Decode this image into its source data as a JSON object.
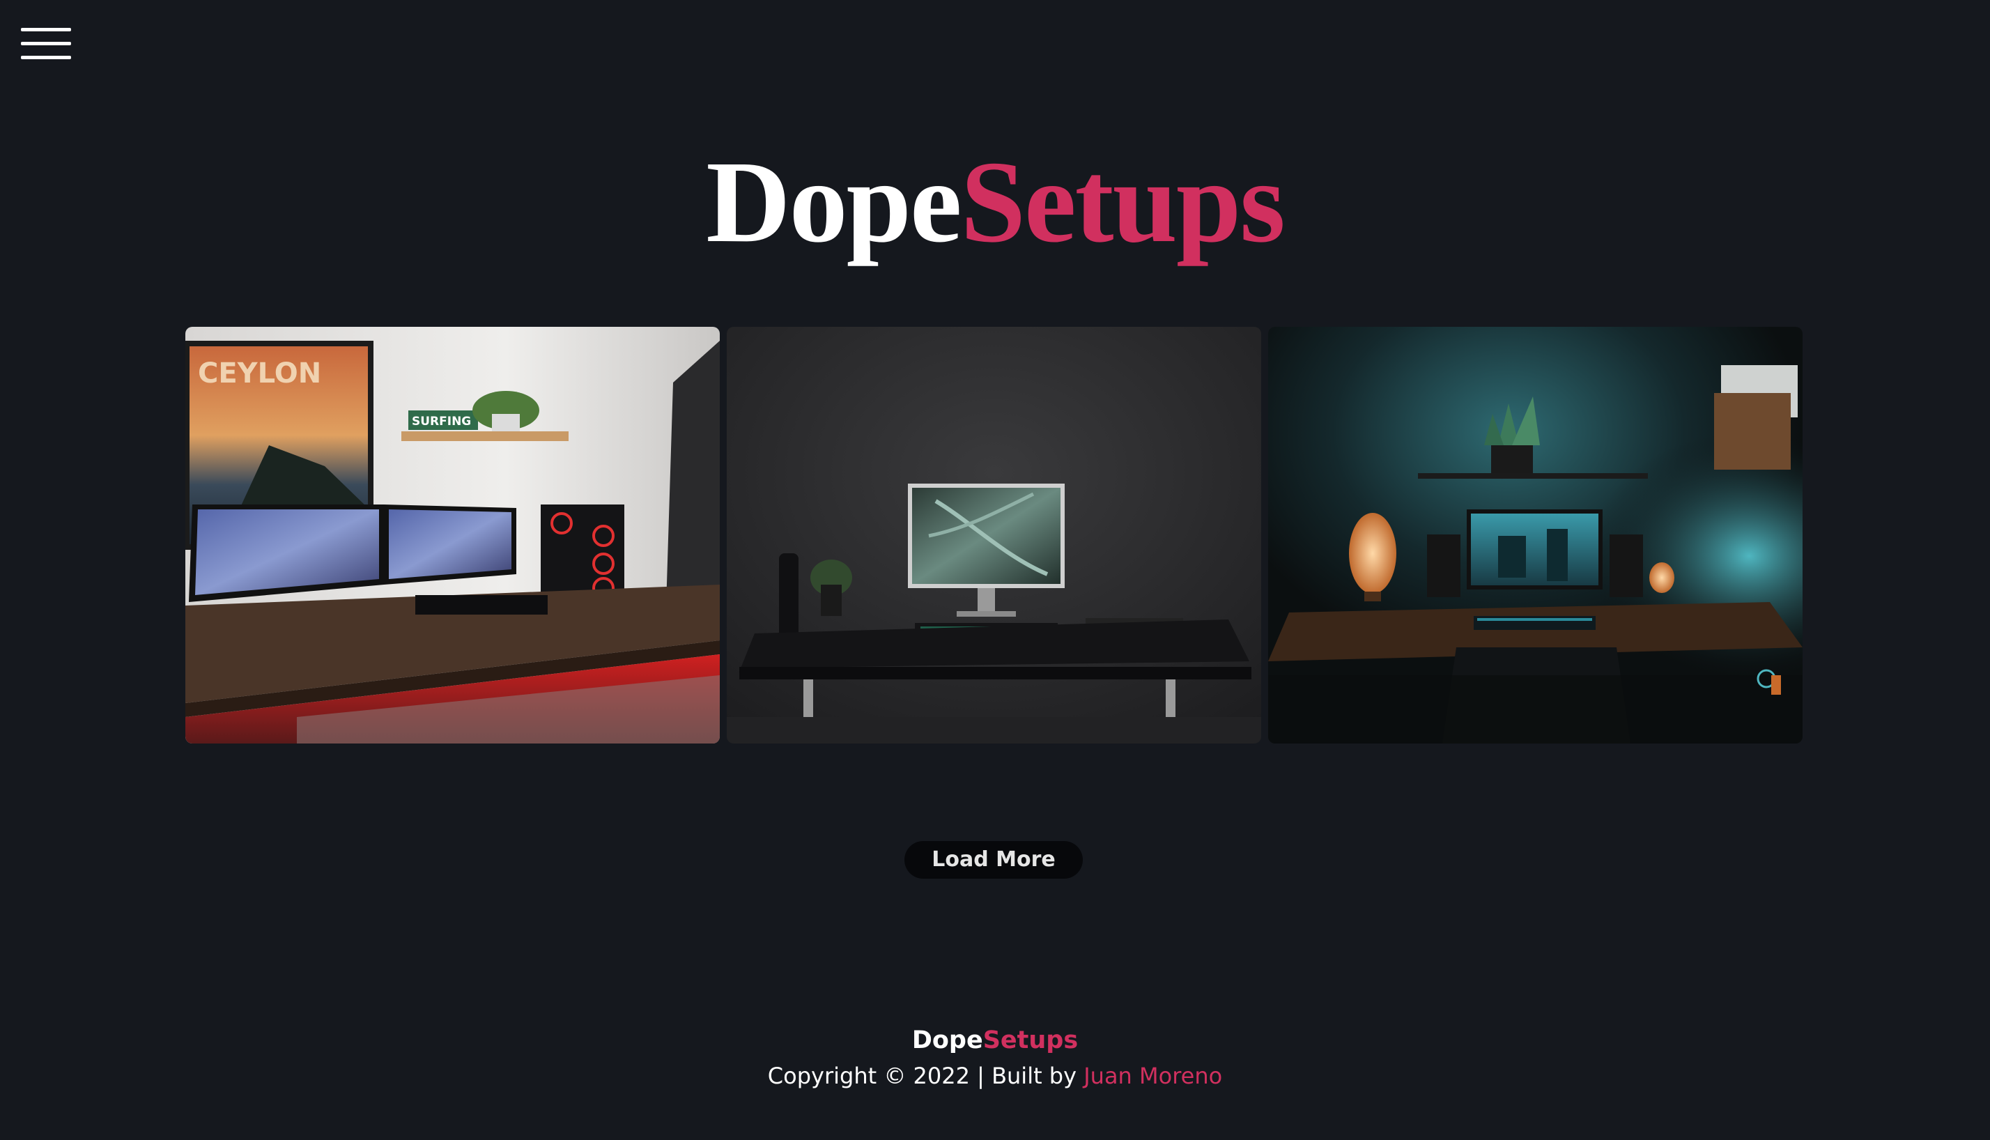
{
  "colors": {
    "background": "#15181e",
    "accent": "#d1305f",
    "button_bg": "#07080b",
    "text": "#ffffff"
  },
  "nav": {
    "menu_icon": "hamburger-menu-icon"
  },
  "logo": {
    "part1": "Dope",
    "part2": "Setups"
  },
  "gallery": {
    "images": [
      {
        "subject": "desk setup with dual curved monitors, red underglow, CEYLON poster and SURFING shelf sign"
      },
      {
        "subject": "minimal dark room desk with single monitor showing leaf wallpaper and small plant"
      },
      {
        "subject": "dark desk setup with teal wall light, table lamps and monitor with city wallpaper"
      }
    ]
  },
  "load_more": {
    "label": "Load More"
  },
  "footer": {
    "brand_part1": "Dope",
    "brand_part2": "Setups",
    "copyright": "Copyright © 2022 | Built by ",
    "author": "Juan Moreno"
  }
}
